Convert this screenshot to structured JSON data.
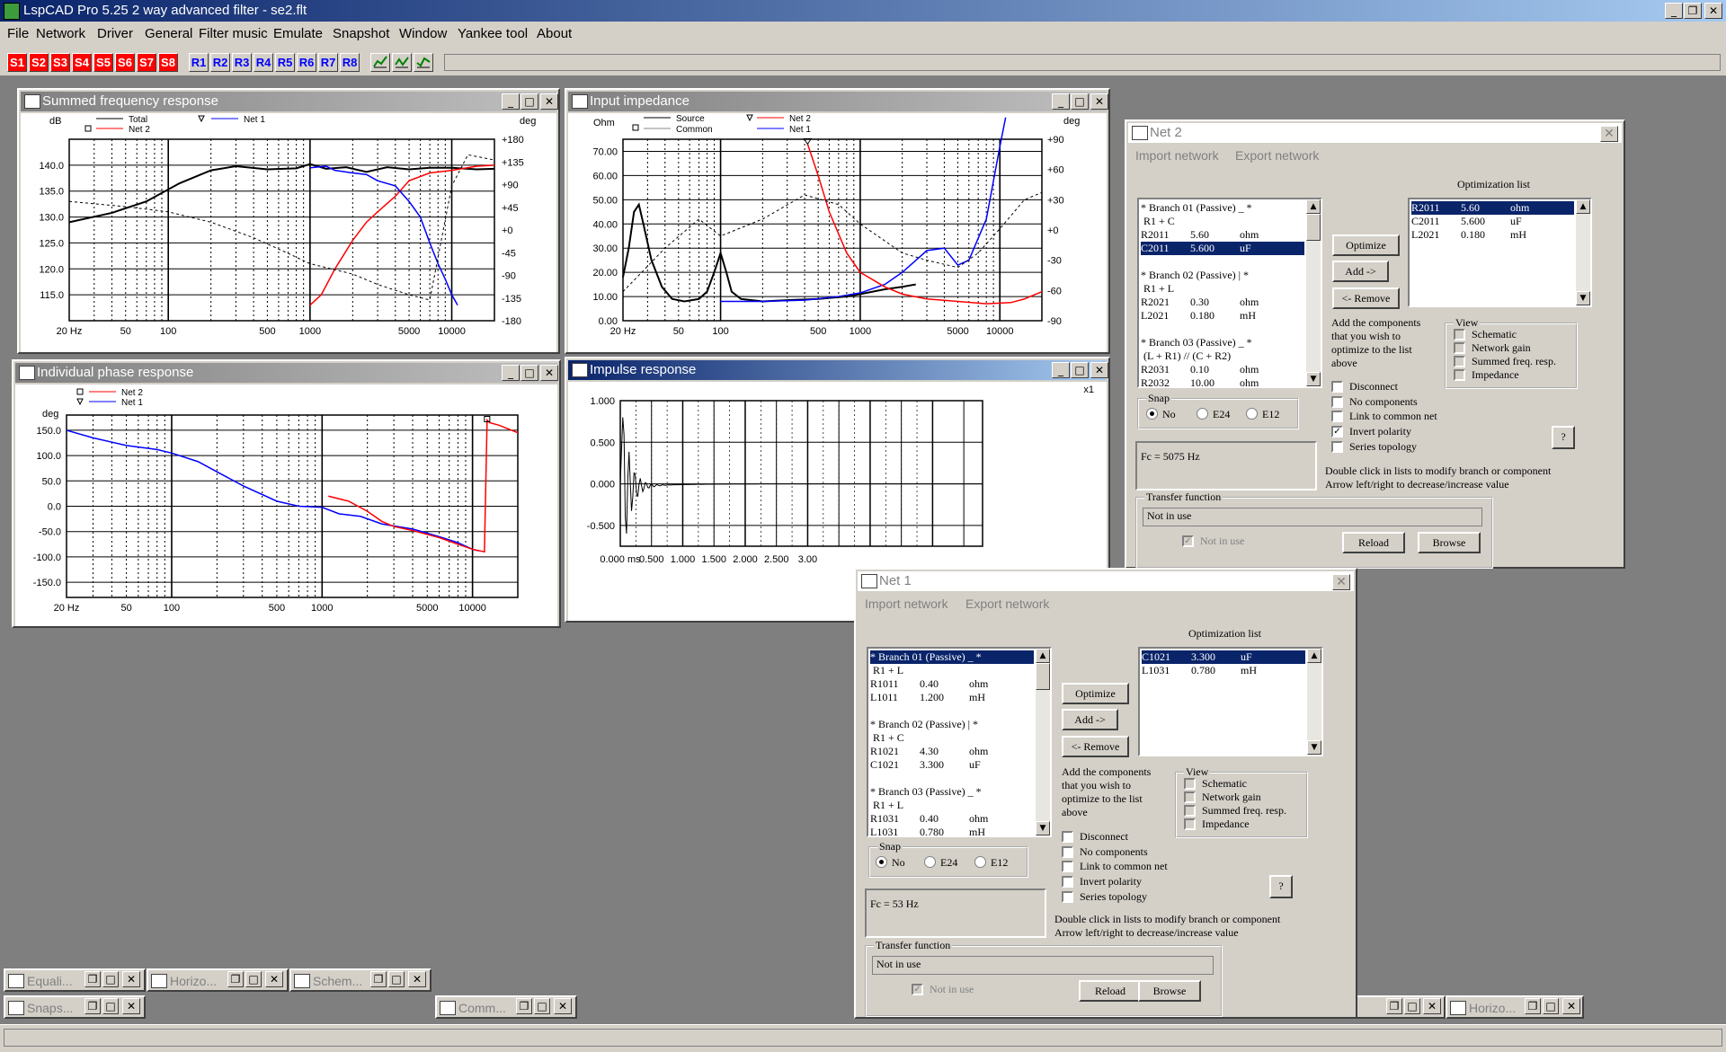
{
  "app": {
    "title": "LspCAD Pro 5.25 2 way advanced filter - se2.flt"
  },
  "menu": [
    "File",
    "Network",
    "Driver",
    "General",
    "Filter music",
    "Emulate",
    "Snapshot",
    "Window",
    "Yankee tool",
    "About"
  ],
  "toolbar": {
    "s_buttons": [
      "S1",
      "S2",
      "S3",
      "S4",
      "S5",
      "S6",
      "S7",
      "S8"
    ],
    "r_buttons": [
      "R1",
      "R2",
      "R3",
      "R4",
      "R5",
      "R6",
      "R7",
      "R8"
    ]
  },
  "windows": {
    "summed": {
      "title": "Summed frequency response",
      "ylabel_left": "dB",
      "ylabel_right": "deg",
      "legend": [
        "Total",
        "Net 2",
        "Net 1"
      ],
      "yticks": [
        "140.0",
        "135.0",
        "130.0",
        "125.0",
        "120.0",
        "115.0"
      ],
      "yticks_right": [
        "+180",
        "+135",
        "+90",
        "+45",
        "+0",
        "-45",
        "-90",
        "-135",
        "-180"
      ],
      "xticks": [
        "20 Hz",
        "50",
        "100",
        "500",
        "1000",
        "5000",
        "10000"
      ]
    },
    "impedance": {
      "title": "Input impedance",
      "ylabel_left": "Ohm",
      "ylabel_right": "deg",
      "legend": [
        "Source",
        "Common",
        "Net 2",
        "Net 1"
      ],
      "yticks": [
        "70.00",
        "60.00",
        "50.00",
        "40.00",
        "30.00",
        "20.00",
        "10.00",
        "0.00"
      ],
      "yticks_right": [
        "+90",
        "+60",
        "+30",
        "+0",
        "-30",
        "-60",
        "-90"
      ],
      "xticks": [
        "20 Hz",
        "50",
        "100",
        "500",
        "1000",
        "5000",
        "10000"
      ]
    },
    "phase": {
      "title": "Individual phase response",
      "ylabel_left": "deg",
      "legend": [
        "Net 2",
        "Net 1"
      ],
      "yticks": [
        "150.0",
        "100.0",
        "50.0",
        "0.0",
        "-50.0",
        "-100.0",
        "-150.0"
      ],
      "xticks": [
        "20 Hz",
        "50",
        "100",
        "500",
        "1000",
        "5000",
        "10000"
      ]
    },
    "impulse": {
      "title": "Impulse response",
      "scale": "x1",
      "yticks": [
        "1.000",
        "0.500",
        "0.000",
        "-0.500"
      ],
      "xticks": [
        "0.000 ms",
        "0.500",
        "1.000",
        "1.500",
        "2.000",
        "2.500",
        "3.00"
      ]
    }
  },
  "minimized": [
    "Equali...",
    "Horizo...",
    "Schem...",
    "Snaps...",
    "Comm...",
    "Horizo..."
  ],
  "net2": {
    "title": "Net 2",
    "import": "Import network",
    "export": "Export network",
    "opt_header": "Optimization list",
    "branches": [
      {
        "t": "* Branch 01 (Passive) _ *"
      },
      {
        "t": " R1 + C"
      },
      {
        "a": "R2011",
        "b": "5.60",
        "c": "ohm"
      },
      {
        "a": "C2011",
        "b": "5.600",
        "c": "uF",
        "sel": true
      },
      {
        "t": ""
      },
      {
        "t": "* Branch 02 (Passive) | *"
      },
      {
        "t": " R1 + L"
      },
      {
        "a": "R2021",
        "b": "0.30",
        "c": "ohm"
      },
      {
        "a": "L2021",
        "b": "0.180",
        "c": "mH"
      },
      {
        "t": ""
      },
      {
        "t": "* Branch 03 (Passive) _ *"
      },
      {
        "t": " (L + R1) // (C + R2)"
      },
      {
        "a": "R2031",
        "b": "0.10",
        "c": "ohm"
      },
      {
        "a": "R2032",
        "b": "10.00",
        "c": "ohm"
      }
    ],
    "opt": [
      {
        "a": "R2011",
        "b": "5.60",
        "c": "ohm",
        "sel": true
      },
      {
        "a": "C2011",
        "b": "5.600",
        "c": "uF"
      },
      {
        "a": "L2021",
        "b": "0.180",
        "c": "mH"
      }
    ],
    "btn_optimize": "Optimize",
    "btn_add": "Add ->",
    "btn_remove": "<- Remove",
    "add_hint": "Add the components that you wish to optimize to the list above",
    "view_label": "View",
    "view": [
      "Schematic",
      "Network gain",
      "Summed freq. resp.",
      "Impedance"
    ],
    "snap_label": "Snap",
    "snap": [
      "No",
      "E24",
      "E12"
    ],
    "options": [
      {
        "l": "Disconnect",
        "c": false
      },
      {
        "l": "No components",
        "c": false
      },
      {
        "l": "Link to common net",
        "c": false
      },
      {
        "l": "Invert polarity",
        "c": true
      },
      {
        "l": "Series topology",
        "c": false
      }
    ],
    "help": "?",
    "fc": "Fc = 5075 Hz",
    "hint1": "Double click in lists to modify branch or component",
    "hint2": "Arrow left/right to decrease/increase value",
    "tf_label": "Transfer function",
    "tf_value": "Not in use",
    "tf_check": "Not in use",
    "btn_reload": "Reload",
    "btn_browse": "Browse"
  },
  "net1": {
    "title": "Net 1",
    "import": "Import network",
    "export": "Export network",
    "opt_header": "Optimization list",
    "branches": [
      {
        "t": "* Branch 01 (Passive) _ *",
        "sel": true
      },
      {
        "t": " R1 + L"
      },
      {
        "a": "R1011",
        "b": "0.40",
        "c": "ohm"
      },
      {
        "a": "L1011",
        "b": "1.200",
        "c": "mH"
      },
      {
        "t": ""
      },
      {
        "t": "* Branch 02 (Passive) | *"
      },
      {
        "t": " R1 + C"
      },
      {
        "a": "R1021",
        "b": "4.30",
        "c": "ohm"
      },
      {
        "a": "C1021",
        "b": "3.300",
        "c": "uF"
      },
      {
        "t": ""
      },
      {
        "t": "* Branch 03 (Passive) _ *"
      },
      {
        "t": " R1 + L"
      },
      {
        "a": "R1031",
        "b": "0.40",
        "c": "ohm"
      },
      {
        "a": "L1031",
        "b": "0.780",
        "c": "mH"
      }
    ],
    "opt": [
      {
        "a": "C1021",
        "b": "3.300",
        "c": "uF",
        "sel": true
      },
      {
        "a": "L1031",
        "b": "0.780",
        "c": "mH"
      }
    ],
    "btn_optimize": "Optimize",
    "btn_add": "Add ->",
    "btn_remove": "<- Remove",
    "add_hint": "Add the components that you wish to optimize to the list above",
    "view_label": "View",
    "view": [
      "Schematic",
      "Network gain",
      "Summed freq. resp.",
      "Impedance"
    ],
    "snap_label": "Snap",
    "snap": [
      "No",
      "E24",
      "E12"
    ],
    "options": [
      {
        "l": "Disconnect",
        "c": false
      },
      {
        "l": "No components",
        "c": false
      },
      {
        "l": "Link to common net",
        "c": false
      },
      {
        "l": "Invert polarity",
        "c": false
      },
      {
        "l": "Series topology",
        "c": false
      }
    ],
    "help": "?",
    "fc": "Fc = 53 Hz",
    "hint1": "Double click in lists to modify branch or component",
    "hint2": "Arrow left/right to decrease/increase value",
    "tf_label": "Transfer function",
    "tf_value": "Not in use",
    "tf_check": "Not in use",
    "btn_reload": "Reload",
    "btn_browse": "Browse"
  },
  "colors": {
    "net1": "#0000ff",
    "net2": "#ff0000",
    "total": "#000000",
    "title_active": "#0a246a",
    "sbutton": "#ff0000",
    "rbutton": "#0000ff"
  }
}
